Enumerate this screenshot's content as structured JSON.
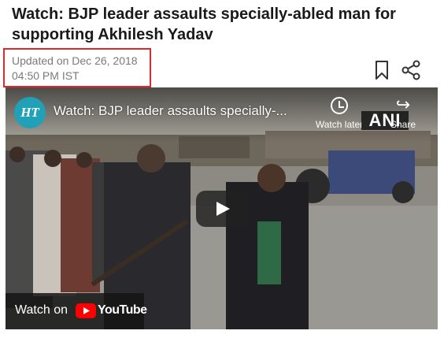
{
  "article": {
    "headline_line1": "Watch: BJP leader assaults specially-abled man for",
    "headline_line2": "supporting Akhilesh Yadav",
    "updated_line1": "Updated on Dec 26, 2018",
    "updated_line2": "04:50 PM IST",
    "highlight_color": "#e0262e"
  },
  "actions": {
    "bookmark_icon": "bookmark-icon",
    "share_icon": "share-icon"
  },
  "video": {
    "channel_avatar": "HT",
    "title": "Watch: BJP leader assaults specially-...",
    "watch_later_label": "Watch later",
    "share_label": "Share",
    "watermark": "ANI",
    "watch_on_label": "Watch on",
    "youtube_wordmark": "YouTube",
    "youtube_red": "#ff0000",
    "avatar_color": "#21a1b8"
  }
}
